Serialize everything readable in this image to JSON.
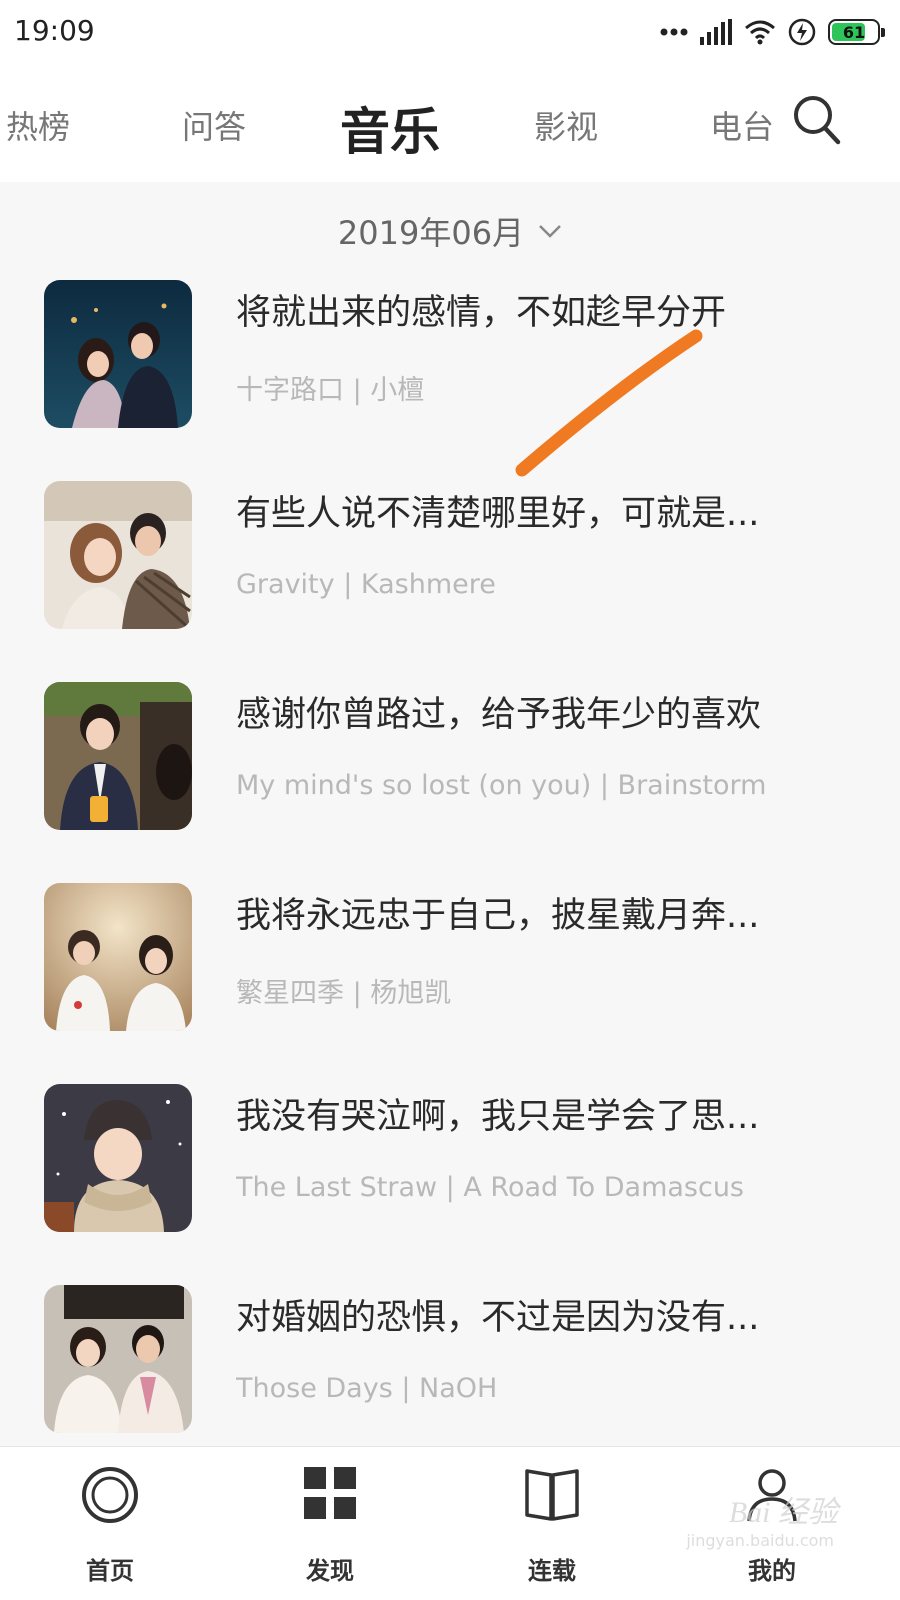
{
  "status_bar": {
    "time": "19:09",
    "battery": "61",
    "battery_color": "#2fc45a",
    "icons": [
      "dots-icon",
      "signal-icon",
      "wifi-icon",
      "charging-icon",
      "battery-icon"
    ]
  },
  "tabs": [
    {
      "label": "热榜",
      "active": false
    },
    {
      "label": "问答",
      "active": false
    },
    {
      "label": "音乐",
      "active": true
    },
    {
      "label": "影视",
      "active": false
    },
    {
      "label": "电台",
      "active": false
    }
  ],
  "month_selector": {
    "label": "2019年06月",
    "icon": "chevron-down-icon"
  },
  "items": [
    {
      "title": "将就出来的感情，不如趁早分开",
      "subtitle": "十字路口 | 小檀"
    },
    {
      "title": "有些人说不清楚哪里好，可就是...",
      "subtitle": "Gravity | Kashmere"
    },
    {
      "title": "感谢你曾路过，给予我年少的喜欢",
      "subtitle": "My mind's so lost (on you)  | Brainstorm"
    },
    {
      "title": "我将永远忠于自己，披星戴月奔...",
      "subtitle": "繁星四季 | 杨旭凯"
    },
    {
      "title": "我没有哭泣啊，我只是学会了思...",
      "subtitle": "The Last Straw | A Road To Damascus"
    },
    {
      "title": "对婚姻的恐惧，不过是因为没有...",
      "subtitle": "Those Days | NaOH"
    }
  ],
  "bottom_nav": [
    {
      "label": "首页",
      "icon": "home-circle-icon"
    },
    {
      "label": "发现",
      "icon": "grid-icon"
    },
    {
      "label": "连载",
      "icon": "book-icon"
    },
    {
      "label": "我的",
      "icon": "person-icon"
    }
  ],
  "watermark": {
    "text": "Bai 经验",
    "sub": "jingyan.baidu.com"
  },
  "colors": {
    "annotation_stroke": "#f07a22",
    "title_text": "#2a2a2a",
    "subtitle_text": "#b8b8b8"
  }
}
